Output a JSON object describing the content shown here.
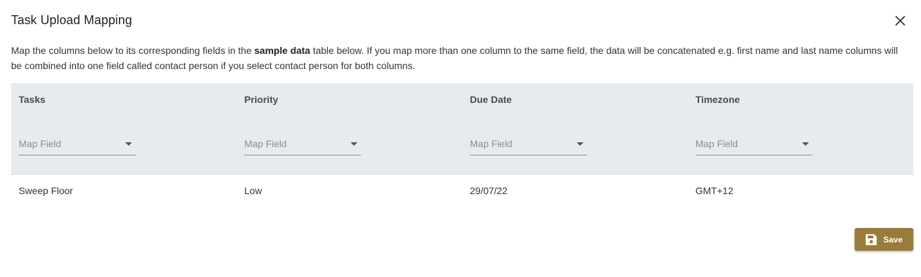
{
  "dialog": {
    "title": "Task Upload Mapping",
    "close_icon": "close-icon"
  },
  "description": {
    "part1": "Map the columns below to its corresponding fields in the ",
    "bold": "sample data",
    "part2": " table below. If you map more than one column to the same field, the data will be concatenated e.g. first name and last name columns will be combined into one field called contact person if you select contact person for both columns."
  },
  "table": {
    "columns": [
      "Tasks",
      "Priority",
      "Due Date",
      "Timezone"
    ],
    "map_placeholder": "Map Field",
    "rows": [
      [
        "Sweep Floor",
        "Low",
        "29/07/22",
        "GMT+12"
      ]
    ]
  },
  "save_button": {
    "label": "Save",
    "icon": "floppy-disk-icon",
    "color": "#9a7b3a"
  }
}
